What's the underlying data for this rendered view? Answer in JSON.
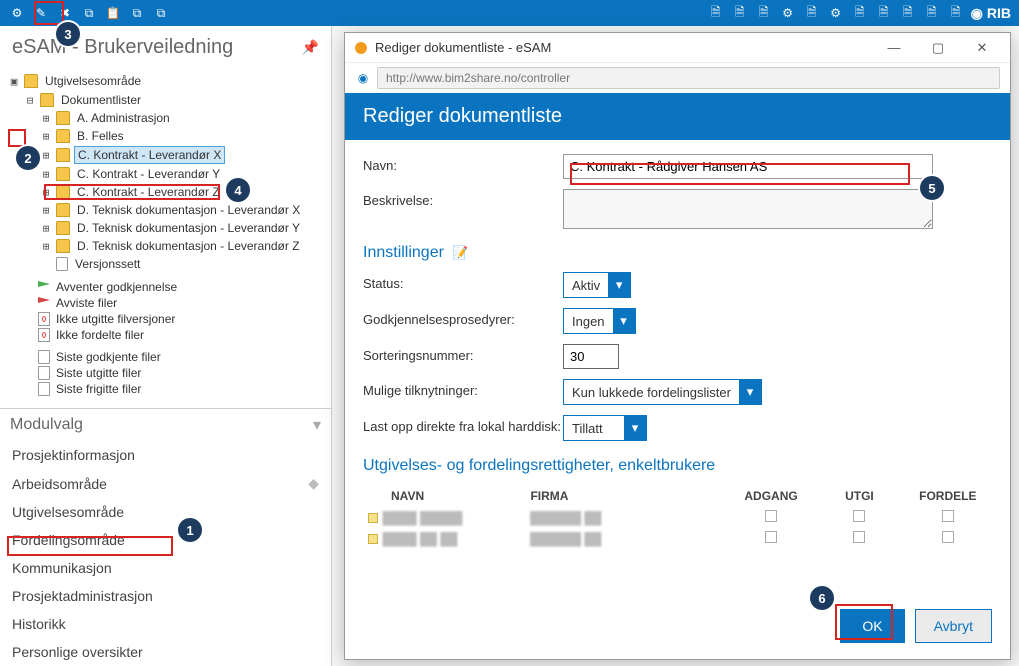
{
  "brand": "RIB",
  "left_title": "eSAM - Brukerveiledning",
  "tree": {
    "root": "Utgivelsesområde",
    "group": "Dokumentlister",
    "items": [
      "A. Administrasjon",
      "B. Felles",
      "C. Kontrakt - Leverandør X",
      "C. Kontrakt - Leverandør Y",
      "C. Kontrakt - Leverandør Z",
      "D. Teknisk dokumentasjon - Leverandør X",
      "D. Teknisk dokumentasjon - Leverandør Y",
      "D. Teknisk dokumentasjon - Leverandør Z",
      "Versjonssett"
    ],
    "status": [
      "Avventer godkjennelse",
      "Avviste filer",
      "Ikke utgitte filversjoner",
      "Ikke fordelte filer"
    ],
    "recent": [
      "Siste godkjente filer",
      "Siste utgitte filer",
      "Siste frigitte filer"
    ]
  },
  "modulvalg": {
    "title": "Modulvalg",
    "items": [
      "Prosjektinformasjon",
      "Arbeidsområde",
      "Utgivelsesområde",
      "Fordelingsområde",
      "Kommunikasjon",
      "Prosjektadministrasjon",
      "Historikk",
      "Personlige oversikter"
    ]
  },
  "dialog": {
    "window_title": "Rediger dokumentliste - eSAM",
    "url": "http://www.bim2share.no/controller",
    "header": "Rediger dokumentliste",
    "fields": {
      "name_label": "Navn:",
      "name_value": "C. Kontrakt - Rådgiver Hansen AS",
      "desc_label": "Beskrivelse:",
      "desc_value": ""
    },
    "settings_header": "Innstillinger",
    "settings": {
      "status_label": "Status:",
      "status_value": "Aktiv",
      "approval_label": "Godkjennelsesprosedyrer:",
      "approval_value": "Ingen",
      "sort_label": "Sorteringsnummer:",
      "sort_value": "30",
      "links_label": "Mulige tilknytninger:",
      "links_value": "Kun lukkede fordelingslister",
      "upload_label": "Last opp direkte fra lokal harddisk:",
      "upload_value": "Tillatt"
    },
    "perm_header": "Utgivelses- og fordelingsrettigheter, enkeltbrukere",
    "perm_cols": {
      "name": "NAVN",
      "firm": "FIRMA",
      "access": "ADGANG",
      "issue": "UTGI",
      "dist": "FORDELE"
    },
    "perm_rows": [
      {
        "name": "████ █████",
        "firm": "██████ ██"
      },
      {
        "name": "████ ██ ██",
        "firm": "██████ ██"
      }
    ],
    "buttons": {
      "ok": "OK",
      "cancel": "Avbryt"
    }
  },
  "callouts": {
    "1": "1",
    "2": "2",
    "3": "3",
    "4": "4",
    "5": "5",
    "6": "6"
  }
}
